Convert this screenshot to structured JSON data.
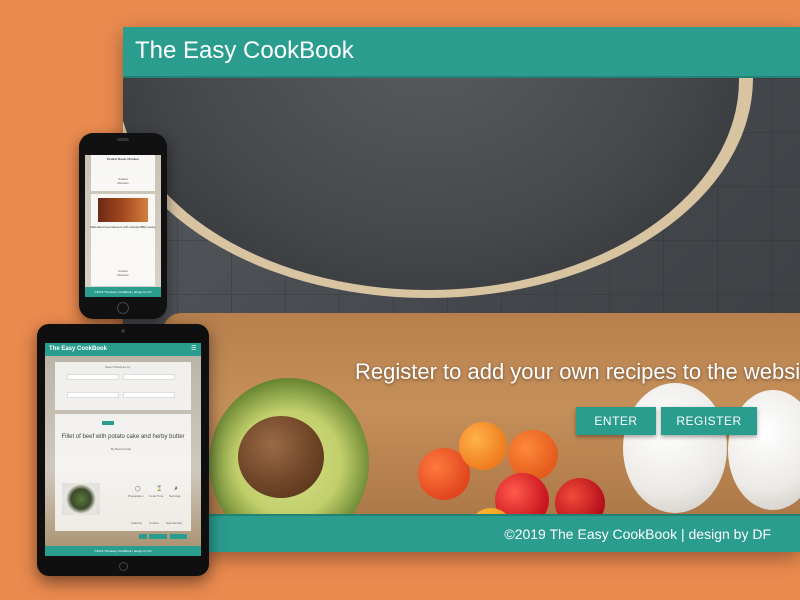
{
  "desktop": {
    "header": {
      "title": "The Easy CookBook"
    },
    "hero": {
      "headline": "Register to add your own recipes to the website!",
      "enter_label": "ENTER",
      "register_label": "REGISTER"
    },
    "footer": {
      "text": "©2019 The Easy CookBook | design by DF"
    }
  },
  "phone": {
    "card_title": "Perfect Roast Chicken",
    "card_line1": "Cuisine",
    "card_line2": "Mexican",
    "recipe_title": "Marinated beef skewers with chipotle BBQ sauce",
    "footer": "©2019 The Easy CookBook | design by DF"
  },
  "tablet": {
    "header": {
      "title": "The Easy CookBook",
      "menu_icon": "hamburger-icon"
    },
    "search_title": "Search Recipes by:",
    "recipe_title": "Fillet of beef with potato cake and herby butter",
    "author": "By Beef Family",
    "labels": {
      "preparation": "Preparation",
      "cook_time": "Cook Time",
      "servings": "Servings"
    },
    "meta": {
      "calories": "Calories",
      "cuisine": "Cuisine",
      "special_diet": "Special Diet"
    },
    "footer": "©2019 The Easy CookBook | design by DF"
  },
  "colors": {
    "accent": "#2a9d8f",
    "background": "#ea8a4f"
  }
}
